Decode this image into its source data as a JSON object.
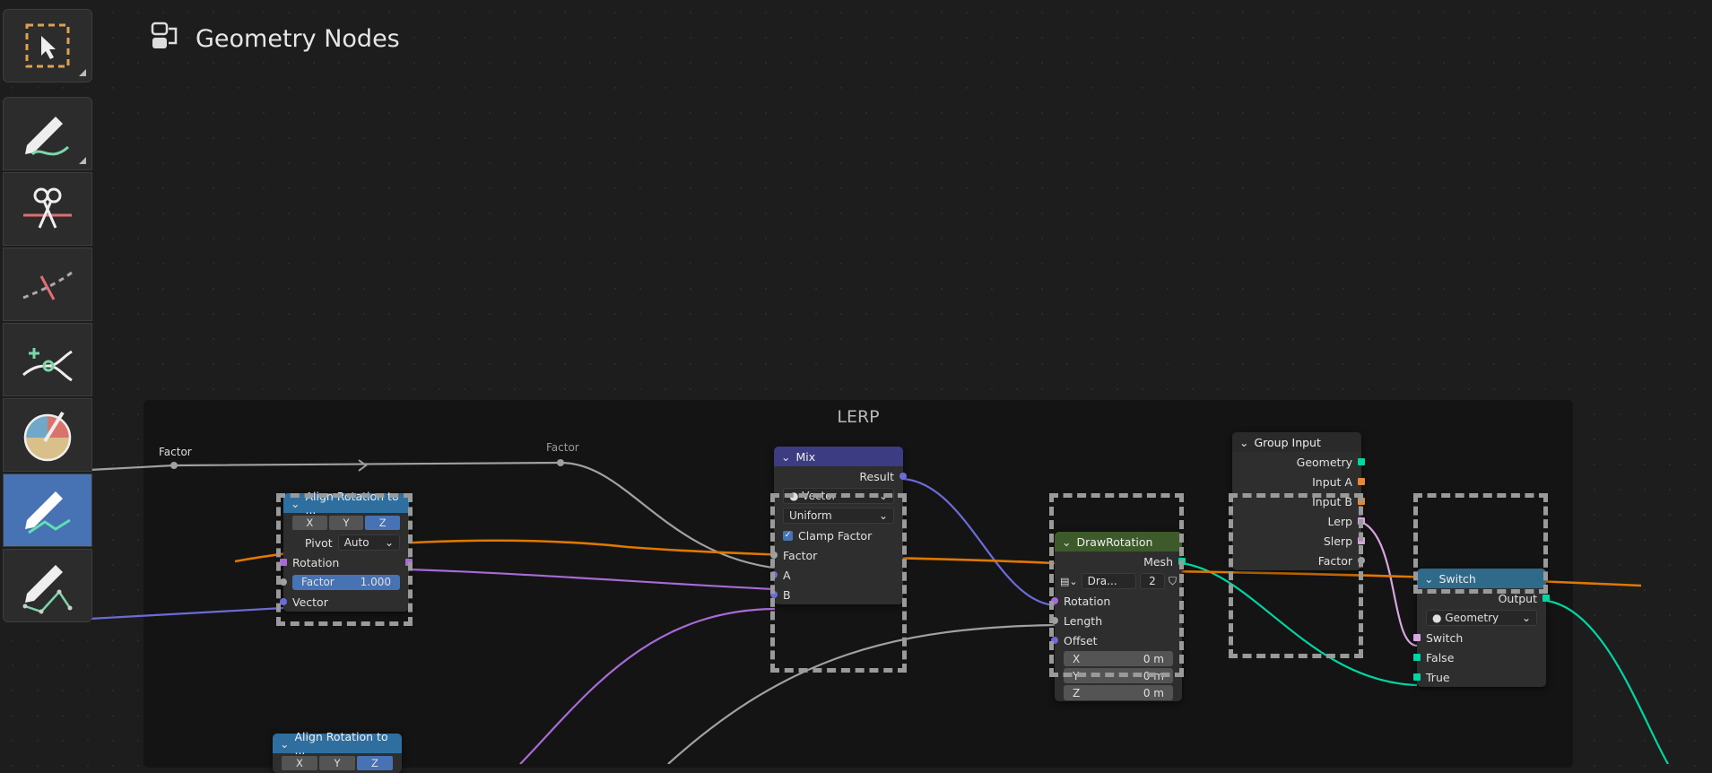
{
  "editor": {
    "title": "Geometry Nodes"
  },
  "frame": {
    "label": "LERP"
  },
  "reroutes": {
    "factor_label_1": "Factor",
    "factor_label_2": "Factor"
  },
  "toolbar": {
    "tools": [
      {
        "name": "select-box"
      },
      {
        "name": "annotate"
      },
      {
        "name": "cut-links"
      },
      {
        "name": "mute-links"
      },
      {
        "name": "add-reroute"
      },
      {
        "name": "paint"
      },
      {
        "name": "annotate-line"
      },
      {
        "name": "annotate-polygon"
      }
    ]
  },
  "nodes": {
    "align1": {
      "title": "Align Rotation to ...",
      "axes": [
        "X",
        "Y",
        "Z"
      ],
      "pivot_label": "Pivot",
      "pivot_value": "Auto",
      "rotation": "Rotation",
      "factor_label": "Factor",
      "factor_value": "1.000",
      "vector": "Vector"
    },
    "align2": {
      "title": "Align Rotation to ...",
      "axes": [
        "X",
        "Y",
        "Z"
      ]
    },
    "mix": {
      "title": "Mix",
      "result": "Result",
      "data_type": "Vector",
      "mode": "Uniform",
      "clamp": "Clamp Factor",
      "factor": "Factor",
      "a": "A",
      "b": "B"
    },
    "draw": {
      "title": "DrawRotation",
      "mesh": "Mesh",
      "group_name": "Dra...",
      "users": "2",
      "rotation": "Rotation",
      "length": "Length",
      "offset": "Offset",
      "x_label": "X",
      "x_value": "0 m",
      "y_label": "Y",
      "y_value": "0 m",
      "z_label": "Z",
      "z_value": "0 m"
    },
    "group_input": {
      "title": "Group Input",
      "outputs": [
        "Geometry",
        "Input A",
        "Input B",
        "Lerp",
        "Slerp",
        "Factor"
      ]
    },
    "switch": {
      "title": "Switch",
      "output": "Output",
      "type": "Geometry",
      "switch": "Switch",
      "false": "False",
      "true": "True"
    }
  },
  "colors": {
    "vector": "#6c6cd9",
    "rotation": "#a86ad6",
    "geometry": "#00d6a3",
    "float": "#a1a1a1",
    "orange": "#e07800"
  }
}
